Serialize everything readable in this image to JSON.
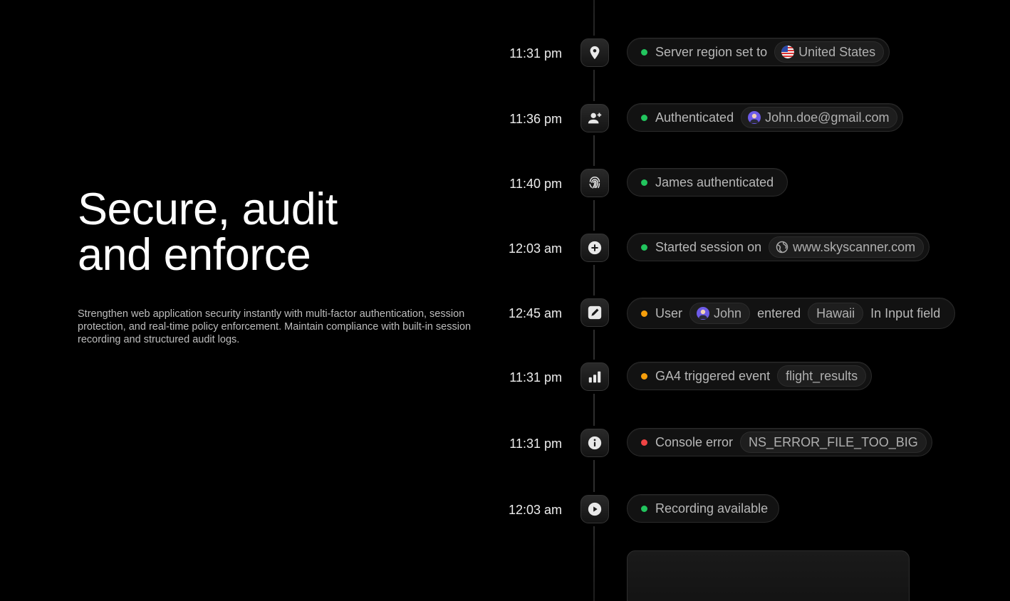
{
  "hero": {
    "title_line1": "Secure, audit",
    "title_line2": "and enforce",
    "description": "Strengthen web application security instantly with multi-factor authentication, session protection, and real-time policy enforcement. Maintain compliance with built-in session recording and structured audit logs."
  },
  "colors": {
    "green": "#22c55e",
    "orange": "#f59e0b",
    "red": "#ef4444",
    "background": "#000000"
  },
  "events": [
    {
      "time": "11:31 pm",
      "icon": "location-pin-icon",
      "status": "green",
      "text": "Server region set to",
      "chip": "United States",
      "chip_icon": "us-flag-icon"
    },
    {
      "time": "11:36 pm",
      "icon": "add-user-icon",
      "status": "green",
      "text": "Authenticated",
      "chip": "John.doe@gmail.com",
      "chip_icon": "avatar-icon"
    },
    {
      "time": "11:40 pm",
      "icon": "fingerprint-icon",
      "status": "green",
      "text": "James authenticated"
    },
    {
      "time": "12:03 am",
      "icon": "plus-circle-icon",
      "status": "green",
      "text": "Started session on",
      "chip": "www.skyscanner.com",
      "chip_icon": "globe-icon"
    },
    {
      "time": "12:45 am",
      "icon": "edit-icon",
      "status": "orange",
      "text_user": "User",
      "chip_user": "John",
      "text_entered": "entered",
      "chip_value": "Hawaii",
      "text_field": "In Input field"
    },
    {
      "time": "11:31 pm",
      "icon": "bar-chart-icon",
      "status": "orange",
      "text": "GA4 triggered event",
      "chip": "flight_results"
    },
    {
      "time": "11:31 pm",
      "icon": "info-icon",
      "status": "red",
      "text": "Console error",
      "chip": "NS_ERROR_FILE_TOO_BIG"
    },
    {
      "time": "12:03 am",
      "icon": "play-icon",
      "status": "green",
      "text": "Recording available"
    }
  ]
}
